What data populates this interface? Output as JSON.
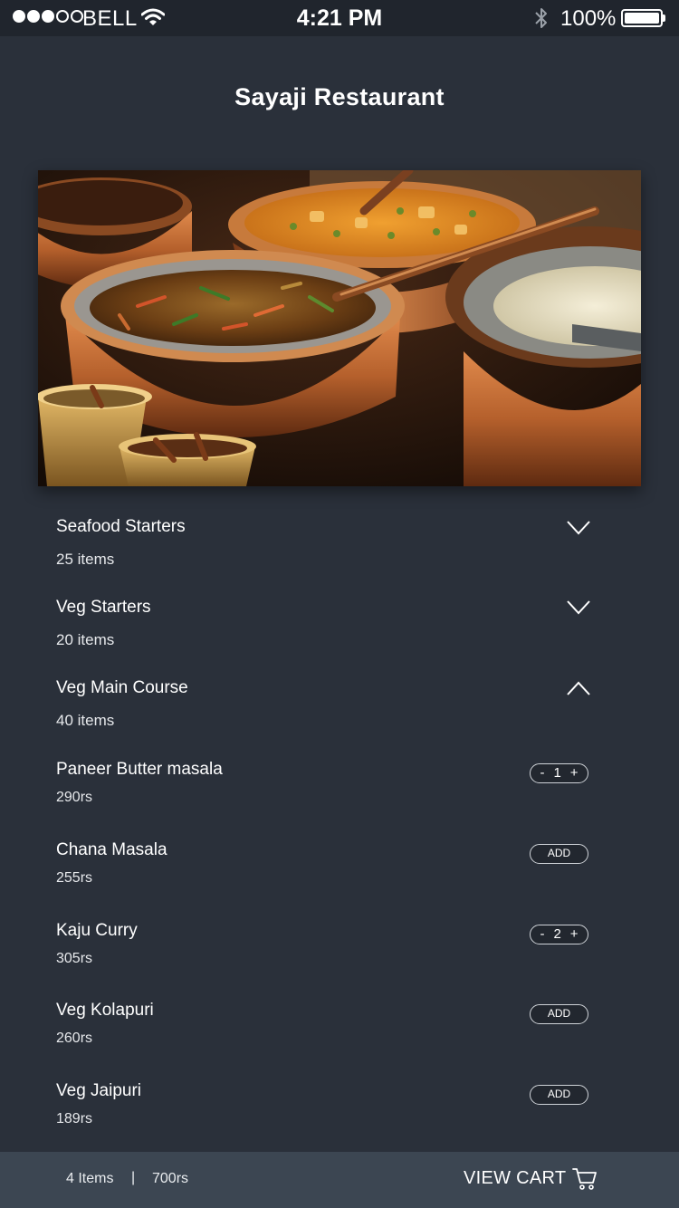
{
  "status_bar": {
    "carrier": "BELL",
    "time": "4:21 PM",
    "battery": "100%",
    "signal_bars": 3,
    "icons": [
      "wifi-icon",
      "bluetooth-icon",
      "battery-icon"
    ]
  },
  "header": {
    "title": "Sayaji Restaurant"
  },
  "categories": [
    {
      "name": "Seafood Starters",
      "count": "25 items",
      "expanded": false
    },
    {
      "name": "Veg Starters",
      "count": "20 items",
      "expanded": false
    },
    {
      "name": "Veg Main Course",
      "count": "40 items",
      "expanded": true
    }
  ],
  "items": [
    {
      "name": "Paneer Butter masala",
      "price": "290rs",
      "qty": "1",
      "minus": "-",
      "plus": "+"
    },
    {
      "name": "Chana Masala",
      "price": "255rs",
      "add": "ADD"
    },
    {
      "name": "Kaju Curry",
      "price": "305rs",
      "qty": "2",
      "minus": "-",
      "plus": "+"
    },
    {
      "name": "Veg Kolapuri",
      "price": "260rs",
      "add": "ADD"
    },
    {
      "name": "Veg Jaipuri",
      "price": "189rs",
      "add": "ADD"
    }
  ],
  "cart": {
    "count": "4 Items",
    "separator": "|",
    "total": "700rs",
    "button_label": "VIEW CART"
  },
  "colors": {
    "background": "#2a303a",
    "status_bar": "#20252d",
    "bottom_bar": "#3c4652",
    "copper": "#b5602c"
  }
}
